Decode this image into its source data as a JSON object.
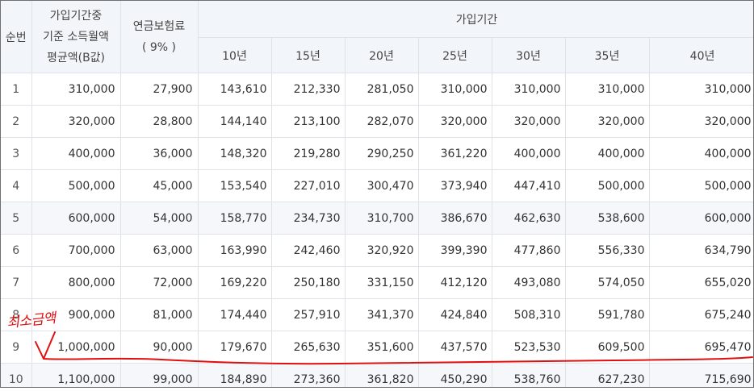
{
  "header": {
    "no": "순번",
    "income_line1": "가입기간중",
    "income_line2": "기준 소득월액",
    "income_line3": "평균액(B값)",
    "premium_line1": "연금보험료",
    "premium_line2": "( 9% )",
    "period": "가입기간",
    "years": [
      "10년",
      "15년",
      "20년",
      "25년",
      "30년",
      "35년",
      "40년"
    ]
  },
  "rows": [
    {
      "no": "1",
      "income": "310,000",
      "premium": "27,900",
      "values": [
        "143,610",
        "212,330",
        "281,050",
        "310,000",
        "310,000",
        "310,000",
        "310,000"
      ]
    },
    {
      "no": "2",
      "income": "320,000",
      "premium": "28,800",
      "values": [
        "144,140",
        "213,100",
        "282,070",
        "320,000",
        "320,000",
        "320,000",
        "320,000"
      ]
    },
    {
      "no": "3",
      "income": "400,000",
      "premium": "36,000",
      "values": [
        "148,320",
        "219,280",
        "290,250",
        "361,220",
        "400,000",
        "400,000",
        "400,000"
      ]
    },
    {
      "no": "4",
      "income": "500,000",
      "premium": "45,000",
      "values": [
        "153,540",
        "227,010",
        "300,470",
        "373,940",
        "447,410",
        "500,000",
        "500,000"
      ]
    },
    {
      "no": "5",
      "income": "600,000",
      "premium": "54,000",
      "values": [
        "158,770",
        "234,730",
        "310,700",
        "386,670",
        "462,630",
        "538,600",
        "600,000"
      ]
    },
    {
      "no": "6",
      "income": "700,000",
      "premium": "63,000",
      "values": [
        "163,990",
        "242,460",
        "320,920",
        "399,390",
        "477,860",
        "556,330",
        "634,790"
      ]
    },
    {
      "no": "7",
      "income": "800,000",
      "premium": "72,000",
      "values": [
        "169,220",
        "250,180",
        "331,150",
        "412,120",
        "493,080",
        "574,050",
        "655,020"
      ]
    },
    {
      "no": "8",
      "income": "900,000",
      "premium": "81,000",
      "values": [
        "174,440",
        "257,910",
        "341,370",
        "424,840",
        "508,310",
        "591,780",
        "675,240"
      ]
    },
    {
      "no": "9",
      "income": "1,000,000",
      "premium": "90,000",
      "values": [
        "179,670",
        "265,630",
        "351,600",
        "437,570",
        "523,530",
        "609,500",
        "695,470"
      ]
    },
    {
      "no": "10",
      "income": "1,100,000",
      "premium": "99,000",
      "values": [
        "184,890",
        "273,360",
        "361,820",
        "450,290",
        "538,760",
        "627,230",
        "715,690"
      ]
    }
  ],
  "annotation": {
    "text": "최소금액",
    "color": "#e01010"
  }
}
